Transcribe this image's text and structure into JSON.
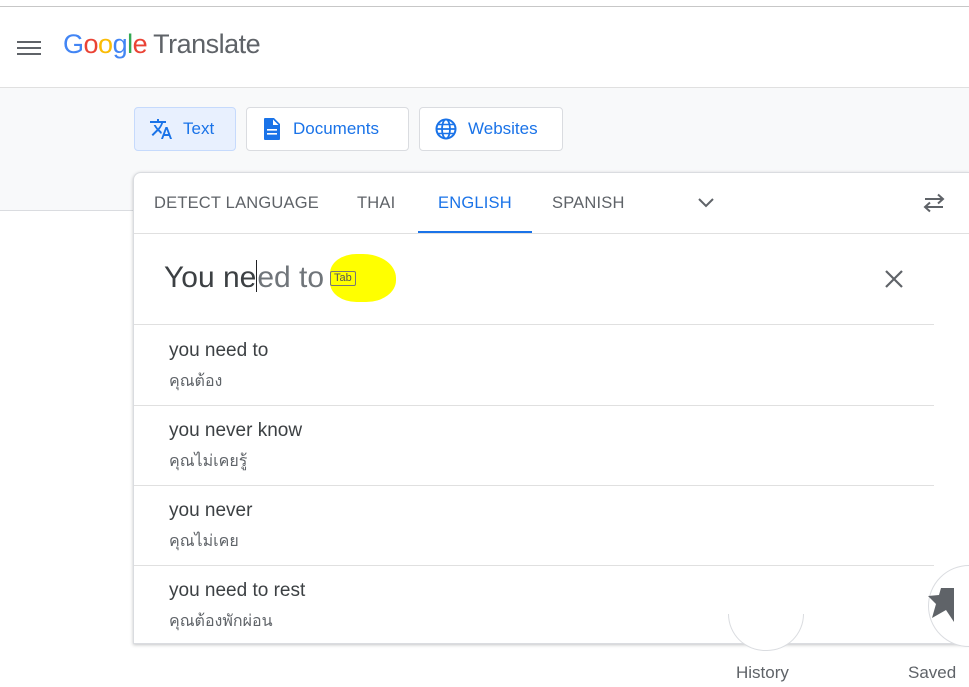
{
  "header": {
    "logo_letters": [
      "G",
      "o",
      "o",
      "g",
      "l",
      "e"
    ],
    "product": "Translate"
  },
  "modes": {
    "text": "Text",
    "documents": "Documents",
    "websites": "Websites"
  },
  "languages": {
    "detect": "DETECT LANGUAGE",
    "thai": "THAI",
    "english": "ENGLISH",
    "spanish": "SPANISH"
  },
  "source": {
    "typed_before_caret": "You ne",
    "typed_after_caret": "ed to",
    "tab_hint": "Tab"
  },
  "suggestions": [
    {
      "en": "you need to",
      "th": "คุณต้อง"
    },
    {
      "en": "you never know",
      "th": "คุณไม่เคยรู้"
    },
    {
      "en": "you never",
      "th": "คุณไม่เคย"
    },
    {
      "en": "you need to rest",
      "th": "คุณต้องพักผ่อน"
    }
  ],
  "footer": {
    "history": "History",
    "saved": "Saved"
  },
  "colors": {
    "accent": "#1a73e8",
    "highlight": "#ffff00"
  }
}
